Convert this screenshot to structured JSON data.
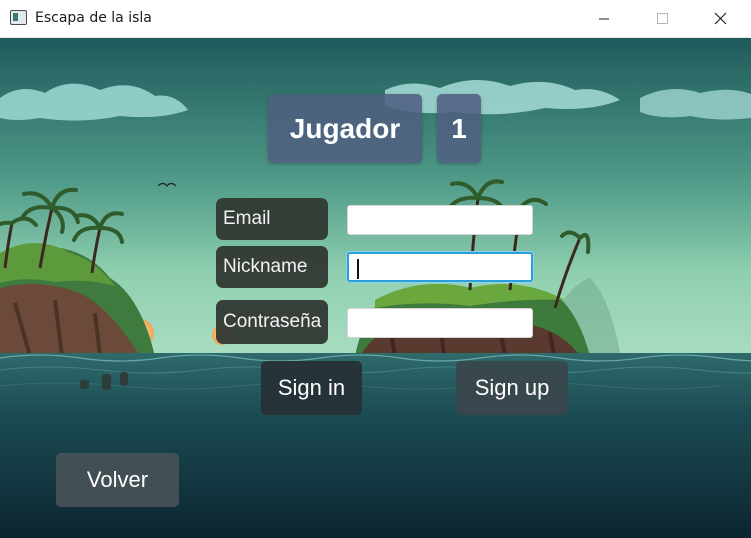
{
  "window": {
    "title": "Escapa de la isla",
    "icon": "app-window-icon"
  },
  "header": {
    "title": "Jugador",
    "player_number": "1"
  },
  "form": {
    "email_label": "Email",
    "nickname_label": "Nickname",
    "password_label": "Contraseña",
    "email_value": "",
    "nickname_value": "",
    "password_value": ""
  },
  "buttons": {
    "sign_in": "Sign in",
    "sign_up": "Sign up",
    "back": "Volver"
  },
  "colors": {
    "panel": "#4e6080",
    "label_bg": "#303832",
    "focus_border": "#2aa0d8",
    "sky_top": "#1f5a5c",
    "sky_bottom": "#8fd0b0",
    "sea_dark": "#0f2a32"
  }
}
